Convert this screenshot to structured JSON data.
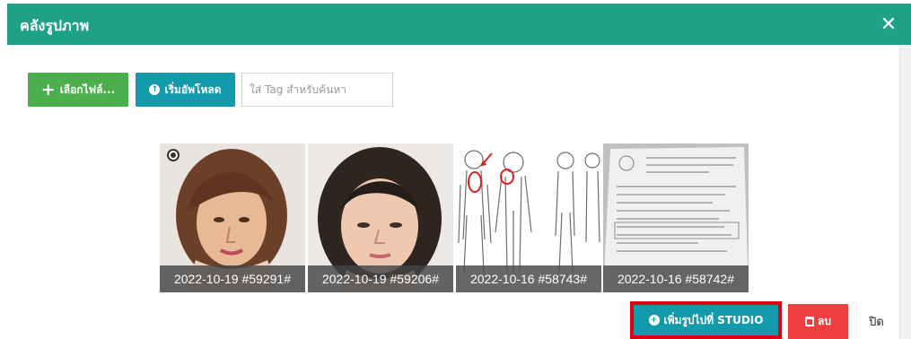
{
  "modal": {
    "title": "คลังรูปภาพ",
    "close_icon": "close-icon"
  },
  "toolbar": {
    "select_file_label": "เลือกไฟล์...",
    "start_upload_label": "เริ่มอัพโหลด",
    "tag_placeholder": "ใส่ Tag สำหรับค้นหา"
  },
  "gallery": {
    "items": [
      {
        "caption": "2022-10-19 #59291#",
        "selected": true,
        "radio_checked": true,
        "kind": "portrait-woman"
      },
      {
        "caption": "2022-10-19 #59206#",
        "selected": true,
        "radio_checked": false,
        "kind": "portrait-woman-2"
      },
      {
        "caption": "2022-10-16 #58743#",
        "selected": false,
        "radio_checked": false,
        "kind": "body-diagram"
      },
      {
        "caption": "2022-10-16 #58742#",
        "selected": false,
        "radio_checked": false,
        "kind": "document-photo"
      }
    ]
  },
  "footer": {
    "add_to_studio_label": "เพิ่มรูปไปที่ STUDIO",
    "delete_label": "ลบ",
    "close_label": "ปิด"
  },
  "colors": {
    "header": "#1fa188",
    "select_button": "#4cae4c",
    "teal_button": "#139bac",
    "delete_button": "#ef3e3e",
    "highlight": "#e00012"
  }
}
